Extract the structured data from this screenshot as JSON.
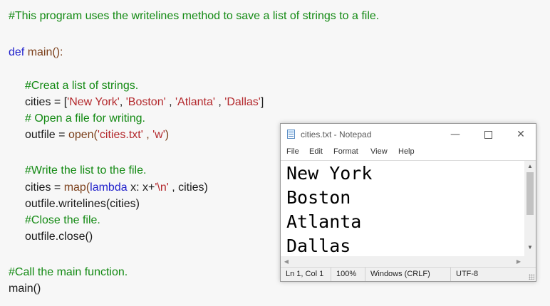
{
  "code": {
    "header_comment": "#This program uses the writelines method to save a list of strings to a file.",
    "def_kw": "def",
    "main_sig": " main():",
    "cmt_create": "#Creat a list of strings.",
    "cities_assign": "cities = [",
    "str_ny": "'New York'",
    "sep1": ", ",
    "str_boston": "'Boston'",
    "sep2": " , ",
    "str_atlanta": "'Atlanta'",
    "sep3": " , ",
    "str_dallas": "'Dallas'",
    "close_bracket": "]",
    "cmt_open": "# Open a file for writing.",
    "outfile_assign": "outfile = ",
    "open_fn": "open(",
    "str_file": "'cities.txt'",
    "sep4": " , ",
    "str_mode": "'w'",
    "close_paren": ")",
    "cmt_write": "#Write the list to the file.",
    "cities_assign2": "cities = ",
    "map_fn": "map(",
    "lambda_kw": "lambda",
    "lambda_body": " x: x+",
    "str_nl": "'\\n'",
    "map_rest": " , cities)",
    "writelines_call": "outfile.writelines(cities)",
    "cmt_close": "#Close the file.",
    "close_call": "outfile.close()",
    "cmt_call_main": "#Call the main function.",
    "main_call": "main()"
  },
  "notepad": {
    "title": "cities.txt - Notepad",
    "minimize": "—",
    "close": "✕",
    "menu": [
      "File",
      "Edit",
      "Format",
      "View",
      "Help"
    ],
    "lines": [
      "New York",
      "Boston",
      "Atlanta",
      "Dallas"
    ],
    "status": {
      "position": "Ln 1, Col 1",
      "zoom": "100%",
      "line_endings": "Windows (CRLF)",
      "encoding": "UTF-8"
    },
    "icons": {
      "app": "notepad-icon",
      "scroll_up": "▲",
      "scroll_down": "▼",
      "scroll_left": "◀",
      "scroll_right": "▶"
    }
  },
  "colors": {
    "comment": "#138a13",
    "keyword": "#2222cc",
    "string": "#b3282c",
    "function": "#7b3f1a"
  }
}
